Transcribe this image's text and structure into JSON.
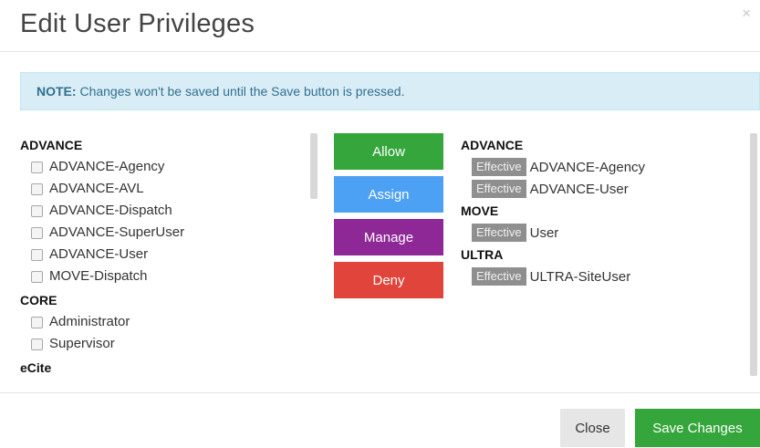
{
  "modal": {
    "title": "Edit User Privileges",
    "close_symbol": "×"
  },
  "note": {
    "label": "NOTE:",
    "text": " Changes won't be saved until the Save button is pressed."
  },
  "left": {
    "groups": [
      {
        "name": "ADVANCE",
        "items": [
          "ADVANCE-Agency",
          "ADVANCE-AVL",
          "ADVANCE-Dispatch",
          "ADVANCE-SuperUser",
          "ADVANCE-User",
          "MOVE-Dispatch"
        ]
      },
      {
        "name": "CORE",
        "items": [
          "Administrator",
          "Supervisor"
        ]
      },
      {
        "name": "eCite",
        "items": []
      }
    ]
  },
  "actions": {
    "allow": "Allow",
    "assign": "Assign",
    "manage": "Manage",
    "deny": "Deny"
  },
  "right": {
    "badge": "Effective",
    "groups": [
      {
        "name": "ADVANCE",
        "items": [
          "ADVANCE-Agency",
          "ADVANCE-User"
        ]
      },
      {
        "name": "MOVE",
        "items": [
          "User"
        ]
      },
      {
        "name": "ULTRA",
        "items": [
          "ULTRA-SiteUser"
        ]
      }
    ]
  },
  "footer": {
    "close": "Close",
    "save": "Save Changes"
  },
  "colors": {
    "allow": "#35a63b",
    "assign": "#4da1f5",
    "manage": "#8e2896",
    "deny": "#e0443a",
    "note_bg": "#d9edf7",
    "badge": "#8f8f8f"
  }
}
